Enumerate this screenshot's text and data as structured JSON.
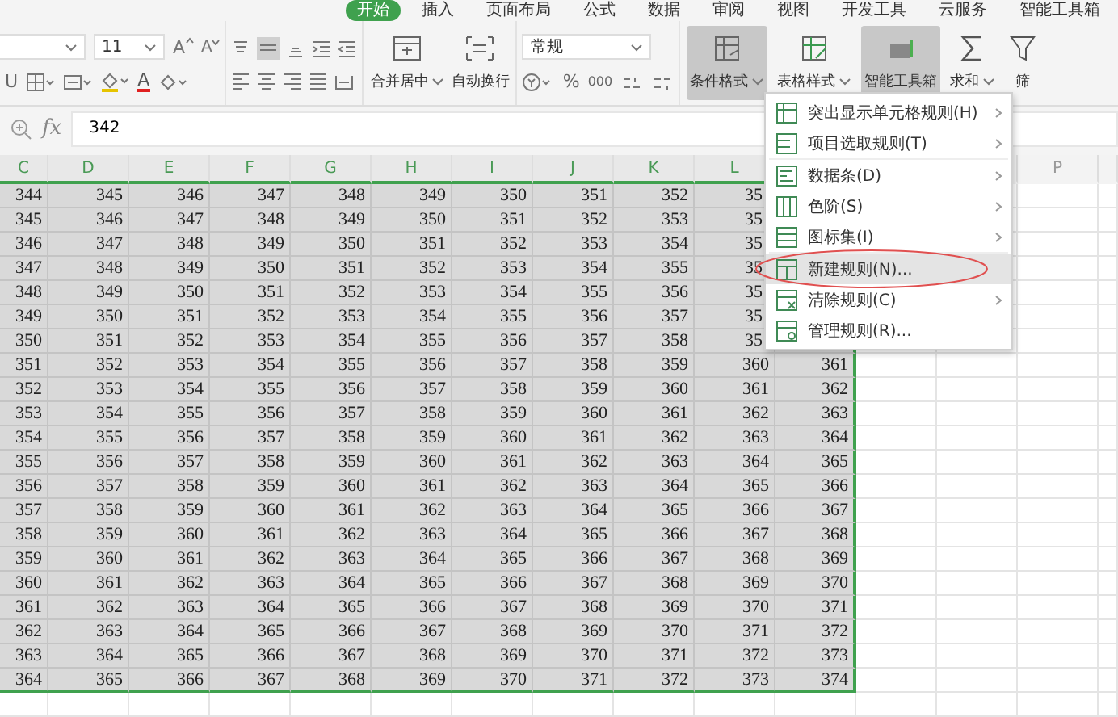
{
  "ribbon_tabs": [
    {
      "label": "开始",
      "selected": true
    },
    {
      "label": "插入",
      "selected": false
    },
    {
      "label": "页面布局",
      "selected": false
    },
    {
      "label": "公式",
      "selected": false
    },
    {
      "label": "数据",
      "selected": false
    },
    {
      "label": "审阅",
      "selected": false
    },
    {
      "label": "视图",
      "selected": false
    },
    {
      "label": "开发工具",
      "selected": false
    },
    {
      "label": "云服务",
      "selected": false
    },
    {
      "label": "智能工具箱",
      "selected": false
    }
  ],
  "font": {
    "size": "11",
    "grow": "A",
    "shrink": "A",
    "underline": "U",
    "font_color": "A"
  },
  "merge_buttons": [
    {
      "label": "合并居中",
      "dropdown": true
    },
    {
      "label": "自动换行",
      "dropdown": false
    }
  ],
  "number_format": {
    "value": "常规",
    "percent": "%",
    "thousands": "000"
  },
  "big_buttons": [
    {
      "label": "条件格式",
      "selected": true,
      "dropdown": true
    },
    {
      "label": "表格样式",
      "selected": false,
      "dropdown": true
    },
    {
      "label": "智能工具箱",
      "selected": true,
      "dropdown": false
    },
    {
      "label": "求和",
      "selected": false,
      "dropdown": true
    },
    {
      "label": "筛",
      "selected": false,
      "dropdown": false
    }
  ],
  "formula_bar": {
    "fx": "fx",
    "value": "342"
  },
  "columns": [
    {
      "label": "C",
      "selected": true
    },
    {
      "label": "D",
      "selected": true
    },
    {
      "label": "E",
      "selected": true
    },
    {
      "label": "F",
      "selected": true
    },
    {
      "label": "G",
      "selected": true
    },
    {
      "label": "H",
      "selected": true
    },
    {
      "label": "I",
      "selected": true
    },
    {
      "label": "J",
      "selected": true
    },
    {
      "label": "K",
      "selected": true
    },
    {
      "label": "L",
      "selected": true
    },
    {
      "selected": true
    },
    {
      "selected": false
    },
    {
      "selected": false
    },
    {
      "label": "P",
      "selected": false
    }
  ],
  "rows": [
    {
      "covered": true,
      "cells": [
        "344",
        "345",
        "346",
        "347",
        "348",
        "349",
        "350",
        "351",
        "352",
        "35",
        null
      ]
    },
    {
      "covered": true,
      "cells": [
        "345",
        "346",
        "347",
        "348",
        "349",
        "350",
        "351",
        "352",
        "353",
        "35",
        null
      ]
    },
    {
      "covered": true,
      "cells": [
        "346",
        "347",
        "348",
        "349",
        "350",
        "351",
        "352",
        "353",
        "354",
        "35",
        null
      ]
    },
    {
      "covered": true,
      "cells": [
        "347",
        "348",
        "349",
        "350",
        "351",
        "352",
        "353",
        "354",
        "355",
        "35",
        null
      ]
    },
    {
      "covered": true,
      "cells": [
        "348",
        "349",
        "350",
        "351",
        "352",
        "353",
        "354",
        "355",
        "356",
        "35",
        null
      ]
    },
    {
      "covered": true,
      "cells": [
        "349",
        "350",
        "351",
        "352",
        "353",
        "354",
        "355",
        "356",
        "357",
        "35",
        null
      ]
    },
    {
      "covered": true,
      "cells": [
        "350",
        "351",
        "352",
        "353",
        "354",
        "355",
        "356",
        "357",
        "358",
        "35",
        null
      ]
    },
    {
      "covered": false,
      "cells": [
        "351",
        "352",
        "353",
        "354",
        "355",
        "356",
        "357",
        "358",
        "359",
        "360",
        "361"
      ]
    },
    {
      "covered": false,
      "cells": [
        "352",
        "353",
        "354",
        "355",
        "356",
        "357",
        "358",
        "359",
        "360",
        "361",
        "362"
      ]
    },
    {
      "covered": false,
      "cells": [
        "353",
        "354",
        "355",
        "356",
        "357",
        "358",
        "359",
        "360",
        "361",
        "362",
        "363"
      ]
    },
    {
      "covered": false,
      "cells": [
        "354",
        "355",
        "356",
        "357",
        "358",
        "359",
        "360",
        "361",
        "362",
        "363",
        "364"
      ]
    },
    {
      "covered": false,
      "cells": [
        "355",
        "356",
        "357",
        "358",
        "359",
        "360",
        "361",
        "362",
        "363",
        "364",
        "365"
      ]
    },
    {
      "covered": false,
      "cells": [
        "356",
        "357",
        "358",
        "359",
        "360",
        "361",
        "362",
        "363",
        "364",
        "365",
        "366"
      ]
    },
    {
      "covered": false,
      "cells": [
        "357",
        "358",
        "359",
        "360",
        "361",
        "362",
        "363",
        "364",
        "365",
        "366",
        "367"
      ]
    },
    {
      "covered": false,
      "cells": [
        "358",
        "359",
        "360",
        "361",
        "362",
        "363",
        "364",
        "365",
        "366",
        "367",
        "368"
      ]
    },
    {
      "covered": false,
      "cells": [
        "359",
        "360",
        "361",
        "362",
        "363",
        "364",
        "365",
        "366",
        "367",
        "368",
        "369"
      ]
    },
    {
      "covered": false,
      "cells": [
        "360",
        "361",
        "362",
        "363",
        "364",
        "365",
        "366",
        "367",
        "368",
        "369",
        "370"
      ]
    },
    {
      "covered": false,
      "cells": [
        "361",
        "362",
        "363",
        "364",
        "365",
        "366",
        "367",
        "368",
        "369",
        "370",
        "371"
      ]
    },
    {
      "covered": false,
      "cells": [
        "362",
        "363",
        "364",
        "365",
        "366",
        "367",
        "368",
        "369",
        "370",
        "371",
        "372"
      ]
    },
    {
      "covered": false,
      "cells": [
        "363",
        "364",
        "365",
        "366",
        "367",
        "368",
        "369",
        "370",
        "371",
        "372",
        "373"
      ]
    },
    {
      "covered": false,
      "cells": [
        "364",
        "365",
        "366",
        "367",
        "368",
        "369",
        "370",
        "371",
        "372",
        "373",
        "374"
      ]
    }
  ],
  "menu": {
    "items": [
      {
        "label": "突出显示单元格规则(H)",
        "submenu": true,
        "highlighted": false,
        "circled": false,
        "divider_after": false
      },
      {
        "label": "项目选取规则(T)",
        "submenu": true,
        "highlighted": false,
        "circled": false,
        "divider_after": true
      },
      {
        "label": "数据条(D)",
        "submenu": true,
        "highlighted": false,
        "circled": false,
        "divider_after": false
      },
      {
        "label": "色阶(S)",
        "submenu": true,
        "highlighted": false,
        "circled": false,
        "divider_after": false
      },
      {
        "label": "图标集(I)",
        "submenu": true,
        "highlighted": false,
        "circled": false,
        "divider_after": true
      },
      {
        "label": "新建规则(N)...",
        "submenu": false,
        "highlighted": true,
        "circled": true,
        "divider_after": false
      },
      {
        "label": "清除规则(C)",
        "submenu": true,
        "highlighted": false,
        "circled": false,
        "divider_after": false
      },
      {
        "label": "管理规则(R)...",
        "submenu": false,
        "highlighted": false,
        "circled": false,
        "divider_after": false
      }
    ]
  }
}
